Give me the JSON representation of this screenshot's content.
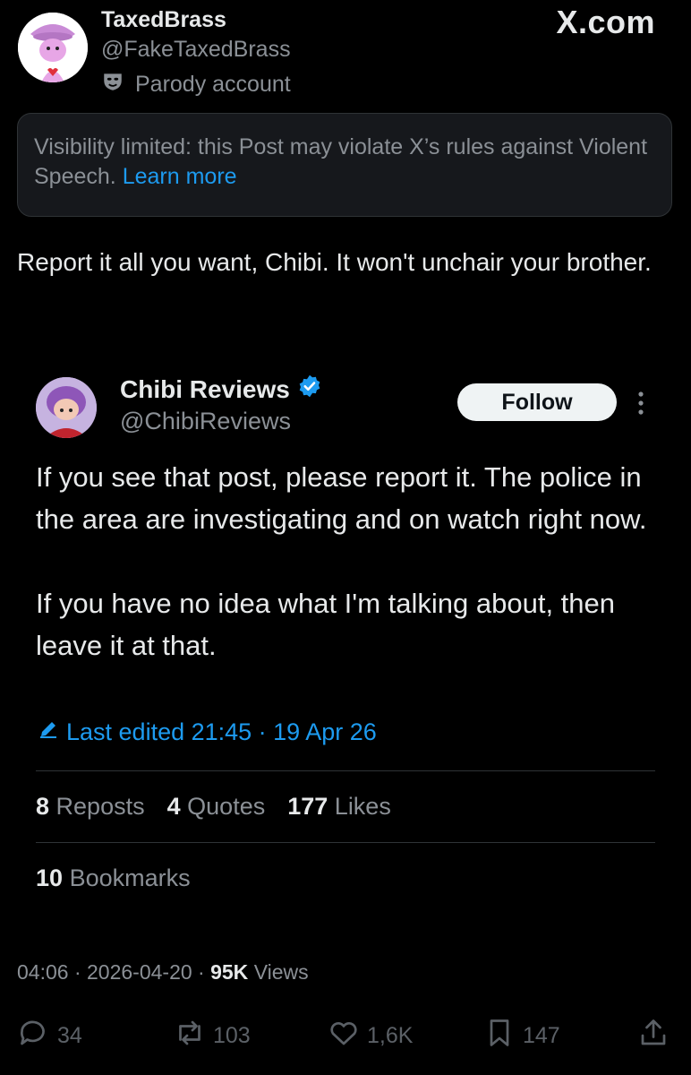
{
  "author": {
    "name": "TaxedBrass",
    "handle": "@FakeTaxedBrass",
    "parody_label": "Parody account"
  },
  "brand": "X.com",
  "notice": {
    "text": "Visibility limited: this Post may violate X’s rules against Violent Speech.",
    "link": "Learn more"
  },
  "post_text": "Report it all you want, Chibi. It won't unchair your brother.",
  "quoted": {
    "name": "Chibi Reviews",
    "handle": "@ChibiReviews",
    "follow_label": "Follow",
    "paragraph1": "If you see that post, please report it. The police in the area are investigating and on watch right now.",
    "paragraph2": "If you have no idea what I'm talking about, then leave it at that.",
    "edited": "Last edited 21:45 · 19 Apr 26",
    "reposts_count": "8",
    "reposts_label": "Reposts",
    "quotes_count": "4",
    "quotes_label": "Quotes",
    "likes_count": "177",
    "likes_label": "Likes",
    "bookmarks_count": "10",
    "bookmarks_label": "Bookmarks"
  },
  "meta": {
    "time": "04:06 · 2026-04-20 · ",
    "views_count": "95K",
    "views_label": "Views"
  },
  "actions": {
    "replies": "34",
    "reposts": "103",
    "likes": "1,6K",
    "bookmarks": "147"
  },
  "colors": {
    "accent": "#1d9bf0",
    "secondary_text": "#8b9096",
    "background": "#000000"
  },
  "icons": [
    "parody-mask-icon",
    "verified-badge-icon",
    "more-options-icon",
    "edit-pencil-icon",
    "reply-icon",
    "repost-icon",
    "like-icon",
    "bookmark-icon",
    "share-icon"
  ]
}
